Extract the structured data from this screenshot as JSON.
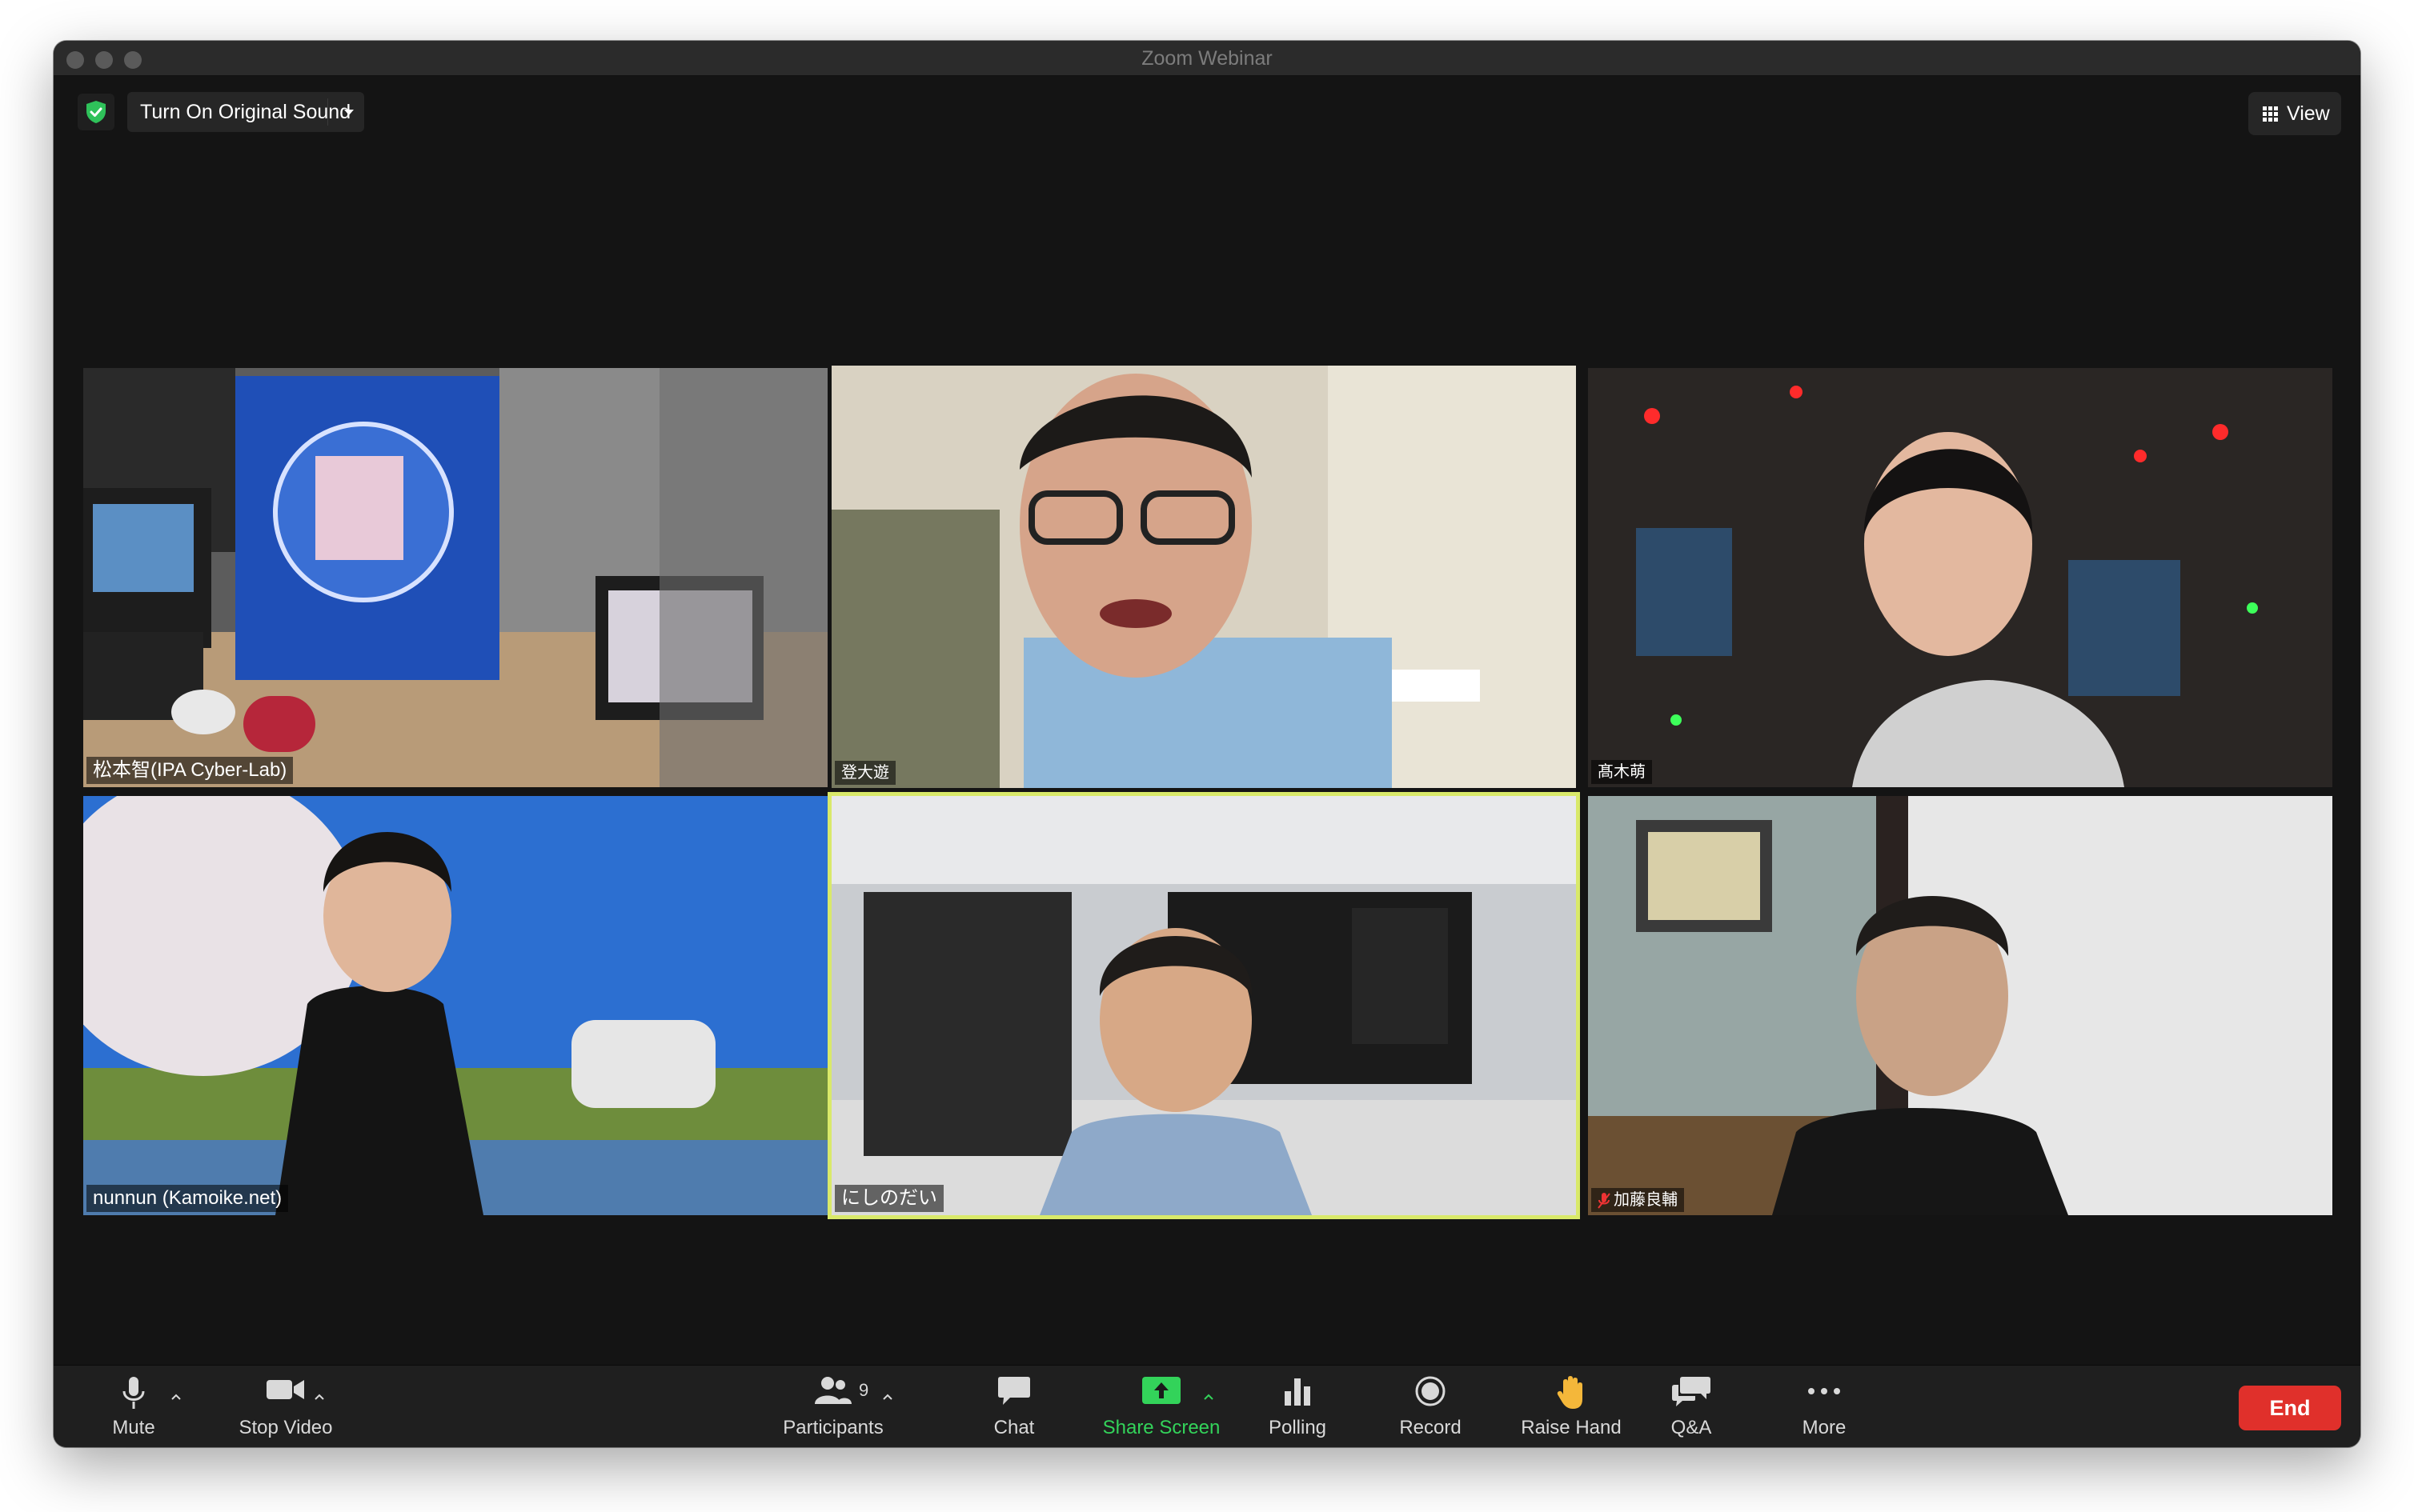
{
  "window": {
    "title": "Zoom Webinar"
  },
  "topbar": {
    "sound_label": "Turn On Original Sound",
    "view_label": "View",
    "security_icon": "shield-check-icon"
  },
  "participants": [
    {
      "name": "松本智(IPA Cyber-Lab)",
      "muted": false,
      "active": false
    },
    {
      "name": "登大遊",
      "muted": false,
      "active": false
    },
    {
      "name": "髙木萌",
      "muted": false,
      "active": false
    },
    {
      "name": "nunnun (Kamoike.net)",
      "muted": false,
      "active": false
    },
    {
      "name": "にしのだい",
      "muted": false,
      "active": true
    },
    {
      "name": "加藤良輔",
      "muted": true,
      "active": false
    }
  ],
  "toolbar": {
    "mute": "Mute",
    "stop_video": "Stop Video",
    "participants": "Participants",
    "participant_count": "9",
    "chat": "Chat",
    "share_screen": "Share Screen",
    "polling": "Polling",
    "record": "Record",
    "raise_hand": "Raise Hand",
    "qa": "Q&A",
    "more": "More",
    "end": "End"
  },
  "colors": {
    "share_green": "#33d35a",
    "end_red": "#e0302b",
    "active_speaker": "#d9e96a"
  }
}
